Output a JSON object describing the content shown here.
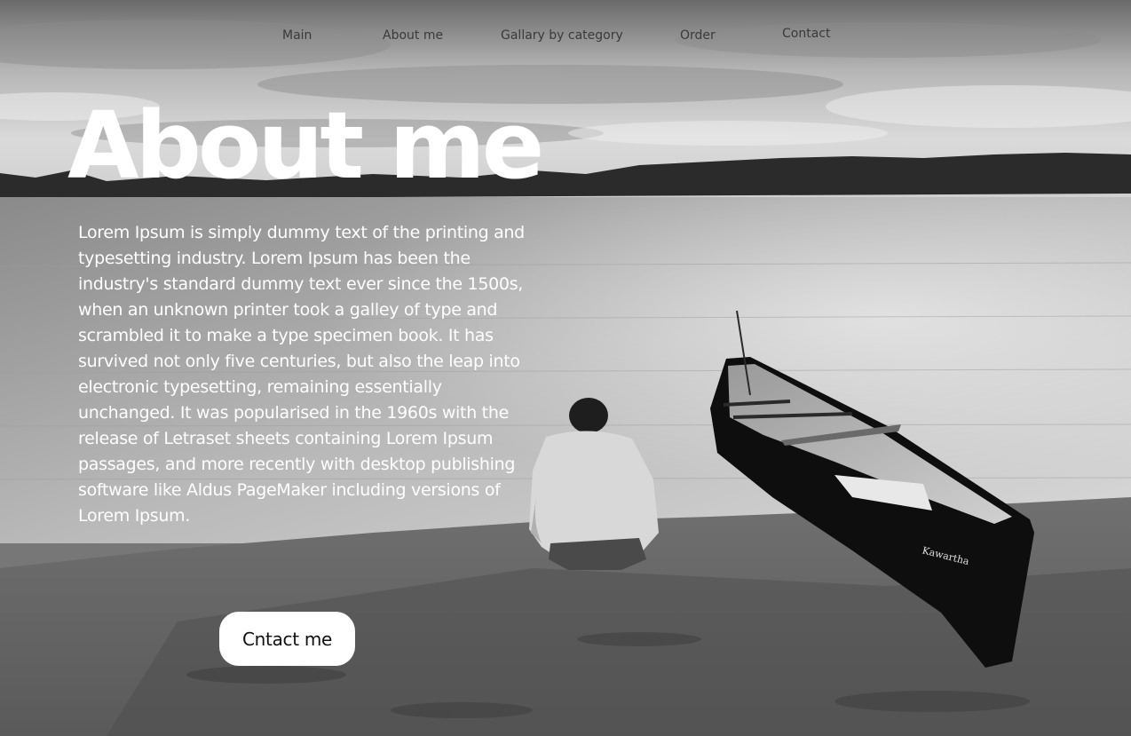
{
  "nav": {
    "items": [
      {
        "label": "Main"
      },
      {
        "label": "About me"
      },
      {
        "label": "Gallary by category"
      },
      {
        "label": "Order"
      },
      {
        "label": "Contact"
      }
    ]
  },
  "hero": {
    "title": "About me",
    "body": "Lorem Ipsum is simply dummy text of the printing and typesetting industry. Lorem Ipsum has been the industry's standard dummy text ever since the 1500s, when an unknown printer took a galley of type and scrambled it to make a type specimen book. It has survived not only five centuries, but also the leap into electronic typesetting, remaining essentially unchanged. It was popularised in the 1960s with the release of Letraset sheets containing Lorem Ipsum passages, and more recently with desktop publishing software like Aldus PageMaker including versions of Lorem Ipsum.",
    "cta_label": "Cntact me",
    "canoe_label": "Kawartha"
  },
  "colors": {
    "title": "#ffffff",
    "nav_text": "#3a3a3a",
    "button_bg": "#ffffff",
    "button_text": "#111111"
  }
}
